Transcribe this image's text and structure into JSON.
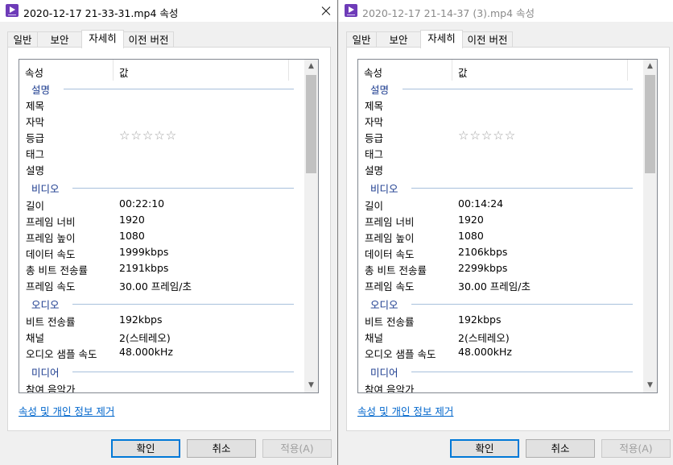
{
  "colors": {
    "link": "#0066cc",
    "group": "#1a3a8e",
    "accent": "#0078d7"
  },
  "icons": {
    "app": "video-file-icon",
    "close": "close-icon",
    "scroll_up": "chevron-up-icon",
    "scroll_down": "chevron-down-icon"
  },
  "dialogs": [
    {
      "title": "2020-12-17 21-33-31.mp4 속성",
      "tabs": [
        "일반",
        "보안",
        "자세히",
        "이전 버전"
      ],
      "active_tab": "자세히",
      "header": {
        "prop": "속성",
        "value": "값"
      },
      "groups": {
        "desc": "설명",
        "video": "비디오",
        "audio": "오디오",
        "media": "미디어"
      },
      "desc": {
        "title": "제목",
        "subtitle": "자막",
        "rating": "등급",
        "rating_value": "☆☆☆☆☆",
        "tags": "태그",
        "comments": "설명"
      },
      "video": {
        "length": {
          "k": "길이",
          "v": "00:22:10"
        },
        "width": {
          "k": "프레임 너비",
          "v": "1920"
        },
        "height": {
          "k": "프레임 높이",
          "v": "1080"
        },
        "datarate": {
          "k": "데이터 속도",
          "v": "1999kbps"
        },
        "bitrate": {
          "k": "총 비트 전송률",
          "v": "2191kbps"
        },
        "framerate": {
          "k": "프레임 속도",
          "v": "30.00 프레임/초"
        }
      },
      "audio": {
        "bitrate": {
          "k": "비트 전송률",
          "v": "192kbps"
        },
        "channels": {
          "k": "채널",
          "v": "2(스테레오)"
        },
        "samplerate": {
          "k": "오디오 샘플 속도",
          "v": "48.000kHz"
        }
      },
      "media": {
        "artist": "참여 음악가"
      },
      "link": "속성 및 개인 정보 제거",
      "buttons": {
        "ok": "확인",
        "cancel": "취소",
        "apply": "적용(A)"
      }
    },
    {
      "title": "2020-12-17 21-14-37 (3).mp4 속성",
      "tabs": [
        "일반",
        "보안",
        "자세히",
        "이전 버전"
      ],
      "active_tab": "자세히",
      "header": {
        "prop": "속성",
        "value": "값"
      },
      "groups": {
        "desc": "설명",
        "video": "비디오",
        "audio": "오디오",
        "media": "미디어"
      },
      "desc": {
        "title": "제목",
        "subtitle": "자막",
        "rating": "등급",
        "rating_value": "☆☆☆☆☆",
        "tags": "태그",
        "comments": "설명"
      },
      "video": {
        "length": {
          "k": "길이",
          "v": "00:14:24"
        },
        "width": {
          "k": "프레임 너비",
          "v": "1920"
        },
        "height": {
          "k": "프레임 높이",
          "v": "1080"
        },
        "datarate": {
          "k": "데이터 속도",
          "v": "2106kbps"
        },
        "bitrate": {
          "k": "총 비트 전송률",
          "v": "2299kbps"
        },
        "framerate": {
          "k": "프레임 속도",
          "v": "30.00 프레임/초"
        }
      },
      "audio": {
        "bitrate": {
          "k": "비트 전송률",
          "v": "192kbps"
        },
        "channels": {
          "k": "채널",
          "v": "2(스테레오)"
        },
        "samplerate": {
          "k": "오디오 샘플 속도",
          "v": "48.000kHz"
        }
      },
      "media": {
        "artist": "참여 음악가"
      },
      "link": "속성 및 개인 정보 제거",
      "buttons": {
        "ok": "확인",
        "cancel": "취소",
        "apply": "적용(A)"
      }
    }
  ]
}
